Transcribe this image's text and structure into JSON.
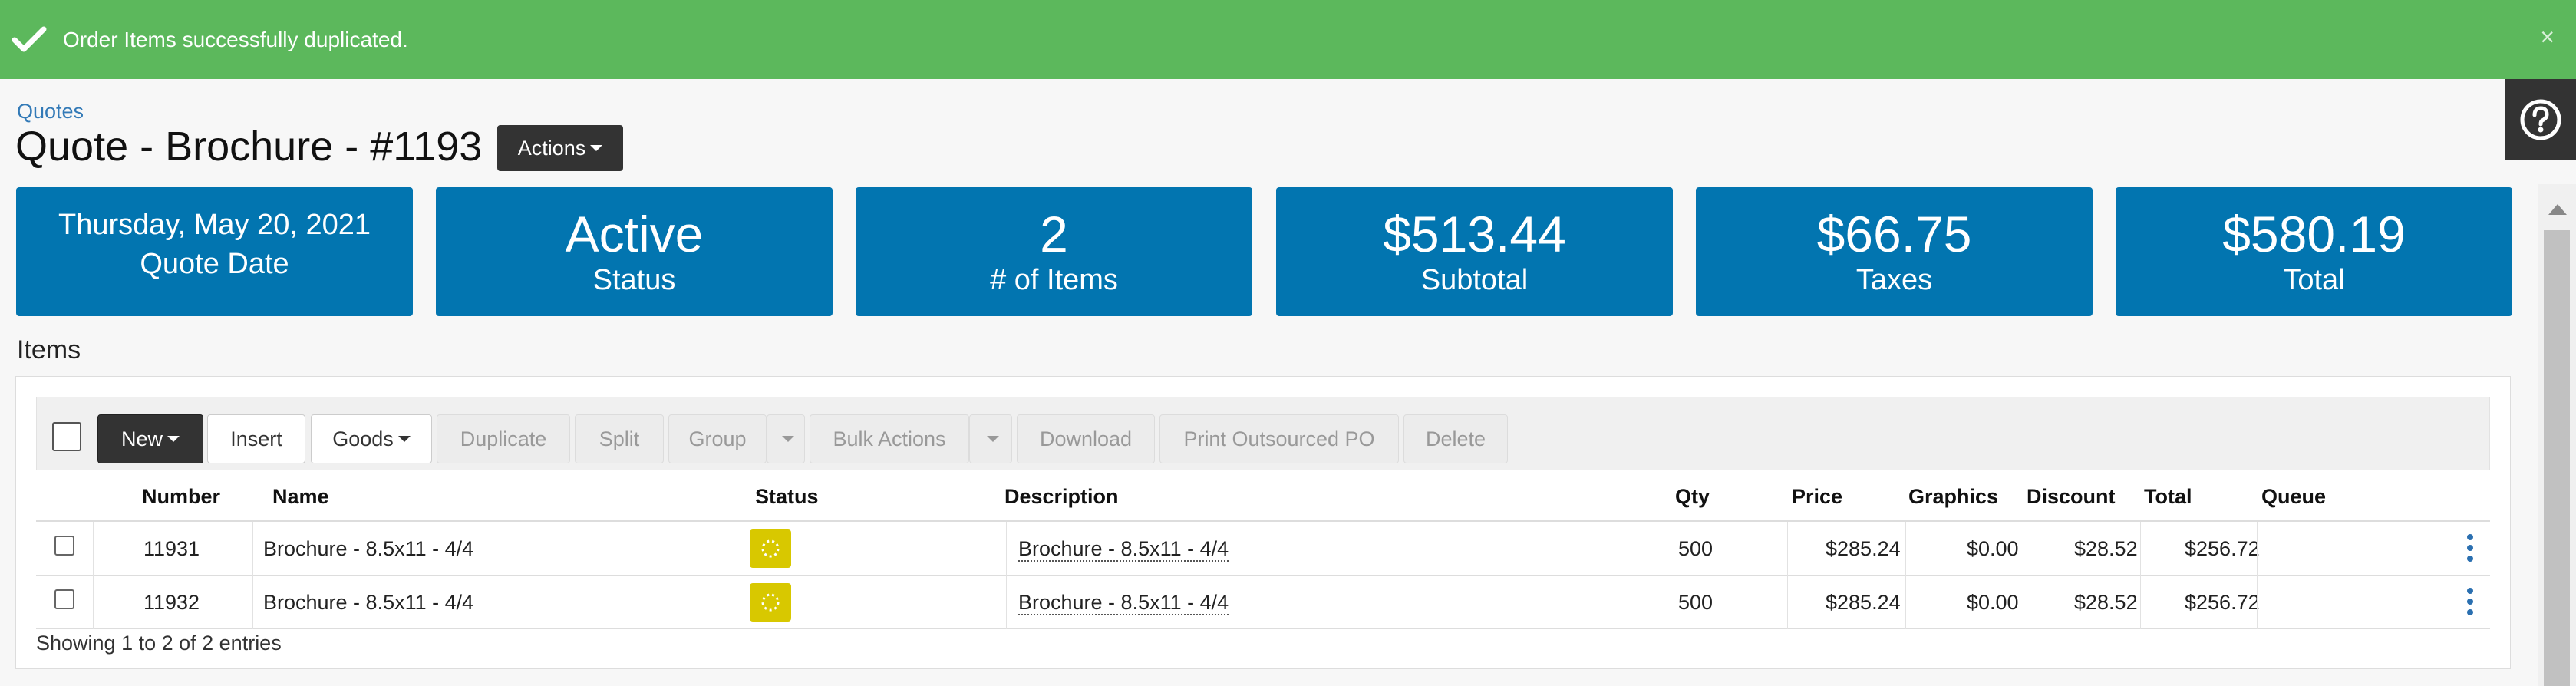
{
  "alert": {
    "message": "Order Items successfully duplicated.",
    "close": "×"
  },
  "breadcrumb": "Quotes",
  "page": {
    "title": "Quote - Brochure - #1193",
    "actions_label": "Actions"
  },
  "stats": [
    {
      "value": "Thursday, May 20, 2021",
      "label": "Quote Date"
    },
    {
      "value": "Active",
      "label": "Status"
    },
    {
      "value": "2",
      "label": "# of Items"
    },
    {
      "value": "$513.44",
      "label": "Subtotal"
    },
    {
      "value": "$66.75",
      "label": "Taxes"
    },
    {
      "value": "$580.19",
      "label": "Total"
    }
  ],
  "items": {
    "heading": "Items",
    "toolbar": {
      "new": "New",
      "insert": "Insert",
      "goods": "Goods",
      "duplicate": "Duplicate",
      "split": "Split",
      "group": "Group",
      "bulk_actions": "Bulk Actions",
      "download": "Download",
      "print_po": "Print Outsourced PO",
      "delete": "Delete"
    },
    "columns": [
      "Number",
      "Name",
      "Status",
      "Description",
      "Qty",
      "Price",
      "Graphics",
      "Discount",
      "Total",
      "Queue"
    ],
    "rows": [
      {
        "number": "11931",
        "name": "Brochure - 8.5x11 - 4/4",
        "description": "Brochure - 8.5x11 - 4/4",
        "qty": "500",
        "price": "$285.24",
        "graphics": "$0.00",
        "discount": "$28.52",
        "total": "$256.72",
        "queue": ""
      },
      {
        "number": "11932",
        "name": "Brochure - 8.5x11 - 4/4",
        "description": "Brochure - 8.5x11 - 4/4",
        "qty": "500",
        "price": "$285.24",
        "graphics": "$0.00",
        "discount": "$28.52",
        "total": "$256.72",
        "queue": ""
      }
    ],
    "footer": "Showing 1 to 2 of 2 entries"
  },
  "colors": {
    "success": "#5cb85c",
    "stat_blue": "#0275b0",
    "status_yellow": "#d8c800",
    "link": "#337ab7"
  },
  "icons": {
    "alert": "check-icon",
    "help": "question-circle-icon",
    "status": "spinner-icon",
    "row_menu": "kebab-icon"
  }
}
